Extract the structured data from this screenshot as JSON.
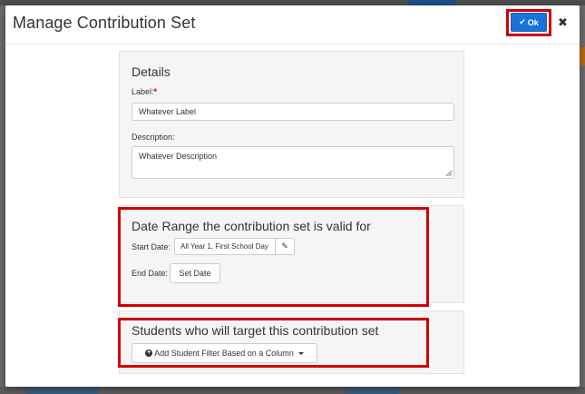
{
  "modal": {
    "title": "Manage Contribution Set",
    "ok_label": "Ok",
    "close_glyph": "✖"
  },
  "details": {
    "title": "Details",
    "label_label": "Label:",
    "required_mark": "*",
    "label_value": "Whatever Label",
    "description_label": "Description:",
    "description_value": "Whatever Description"
  },
  "date_range": {
    "title": "Date Range the contribution set is valid for",
    "start_label": "Start Date:",
    "start_value": "All Year 1, First School Day",
    "end_label": "End Date:",
    "set_date_label": "Set Date"
  },
  "students": {
    "title": "Students who will target this contribution set",
    "add_filter_label": "Add Student Filter Based on a Column"
  },
  "icons": {
    "ok": "check-icon",
    "close": "close-icon",
    "edit": "pencil-icon",
    "add": "plus-circle-icon",
    "dropdown": "caret-down-icon"
  },
  "colors": {
    "primary": "#1a73d9",
    "highlight": "#d00000",
    "panel": "#f5f5f5"
  }
}
